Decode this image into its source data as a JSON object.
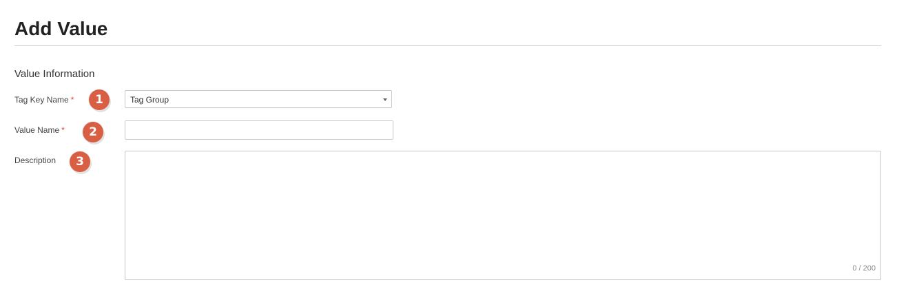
{
  "header": {
    "title": "Add Value"
  },
  "section": {
    "title": "Value Information"
  },
  "fields": {
    "tag_key": {
      "label": "Tag Key Name",
      "required_mark": "*",
      "value": "Tag Group",
      "badge": "1"
    },
    "value_name": {
      "label": "Value Name",
      "required_mark": "*",
      "value": "",
      "badge": "2"
    },
    "description": {
      "label": "Description",
      "value": "",
      "badge": "3",
      "counter": "0 / 200"
    }
  },
  "colors": {
    "badge": "#d85f44",
    "required": "#e0443b",
    "border": "#c8c8c8"
  }
}
